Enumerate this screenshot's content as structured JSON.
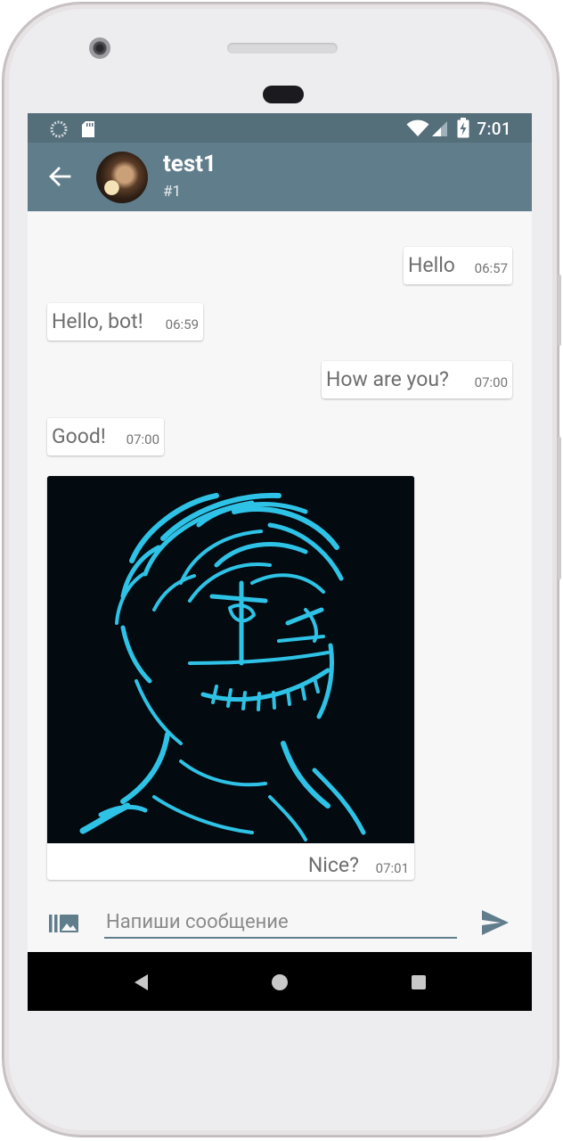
{
  "status_bar": {
    "time": "7:01",
    "icons": [
      "sync-icon",
      "sd-card-icon",
      "wifi-icon",
      "cell-signal-icon",
      "battery-charging-icon"
    ]
  },
  "toolbar": {
    "contact_name": "test1",
    "contact_subtitle": "#1"
  },
  "messages": [
    {
      "text": "Hello",
      "time": "06:57",
      "side": "outgoing"
    },
    {
      "text": "Hello, bot!",
      "time": "06:59",
      "side": "incoming"
    },
    {
      "text": "How are you?",
      "time": "07:00",
      "side": "outgoing"
    },
    {
      "text": "Good!",
      "time": "07:00",
      "side": "incoming"
    },
    {
      "type": "image",
      "caption": "Nice?",
      "time": "07:01",
      "side": "incoming"
    }
  ],
  "composer": {
    "placeholder": "Напиши сообщение",
    "value": ""
  },
  "colors": {
    "statusbar": "#546e7a",
    "toolbar": "#607d8b",
    "accent": "#607d8b",
    "chat_bg": "#f7f7f8",
    "image_line": "#2ec3e6"
  }
}
